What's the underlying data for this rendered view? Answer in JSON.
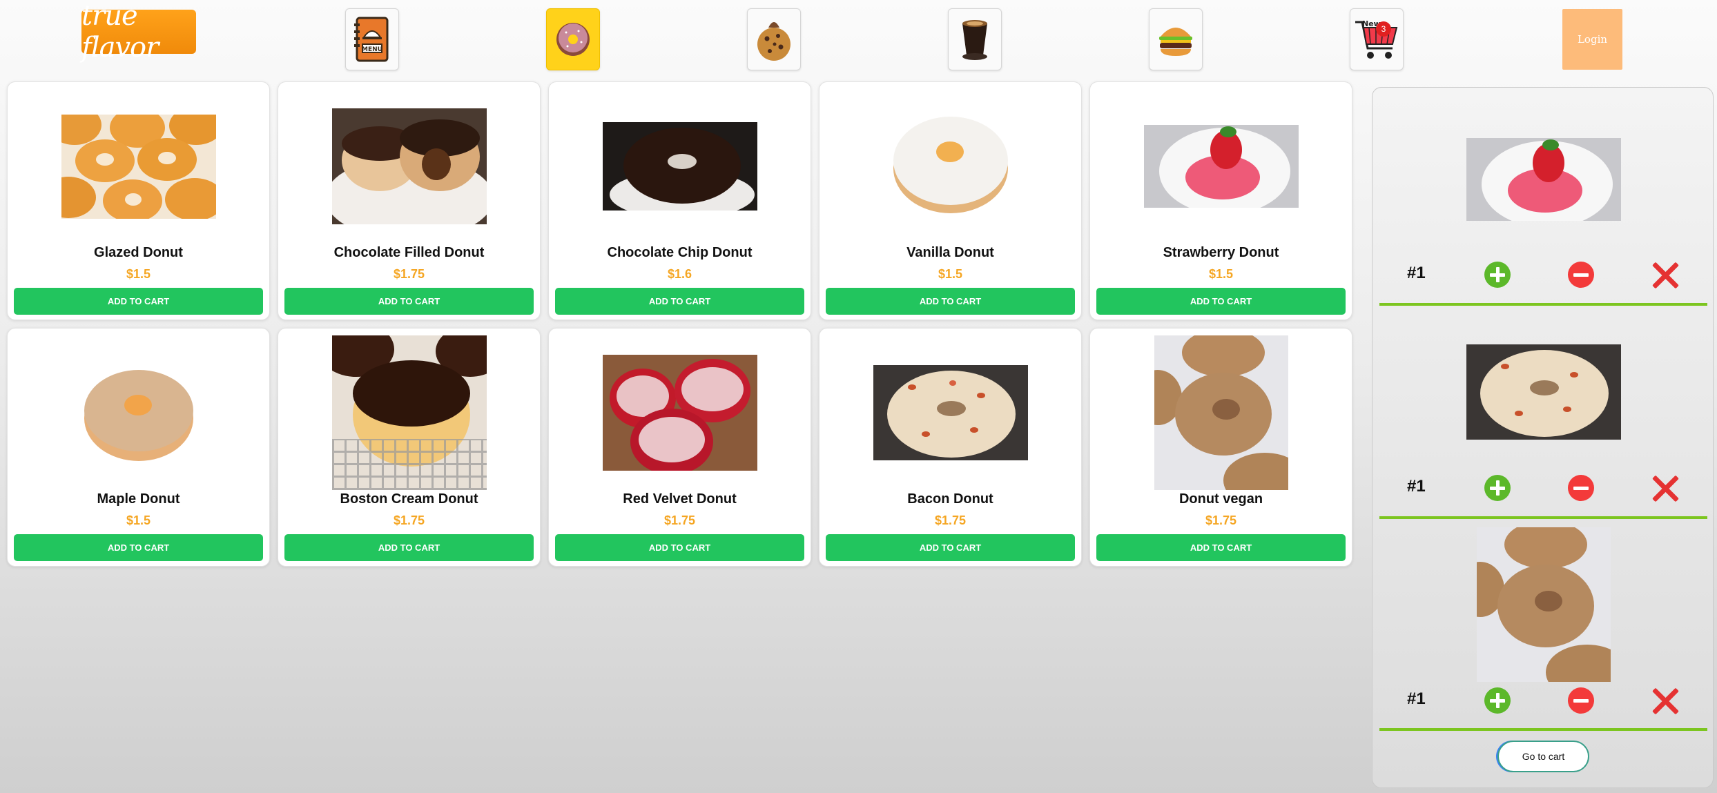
{
  "header": {
    "logo_text": "true flavor",
    "nav": [
      {
        "icon": "menu-book-icon"
      },
      {
        "icon": "donut-icon"
      },
      {
        "icon": "cookie-icon"
      },
      {
        "icon": "coffee-icon"
      },
      {
        "icon": "burger-icon"
      },
      {
        "icon": "shopping-cart-icon",
        "badge": "3"
      }
    ],
    "login_label": "Login"
  },
  "products": [
    {
      "name": "Glazed Donut",
      "price": "$1.5",
      "button": "ADD TO CART"
    },
    {
      "name": "Chocolate Filled Donut",
      "price": "$1.75",
      "button": "ADD TO CART"
    },
    {
      "name": "Chocolate Chip Donut",
      "price": "$1.6",
      "button": "ADD TO CART"
    },
    {
      "name": "Vanilla Donut",
      "price": "$1.5",
      "button": "ADD TO CART"
    },
    {
      "name": "Strawberry Donut",
      "price": "$1.5",
      "button": "ADD TO CART"
    },
    {
      "name": "Maple Donut",
      "price": "$1.5",
      "button": "ADD TO CART"
    },
    {
      "name": "Boston Cream Donut",
      "price": "$1.75",
      "button": "ADD TO CART"
    },
    {
      "name": "Red Velvet Donut",
      "price": "$1.75",
      "button": "ADD TO CART"
    },
    {
      "name": "Bacon Donut",
      "price": "$1.75",
      "button": "ADD TO CART"
    },
    {
      "name": "Donut vegan",
      "price": "$1.75",
      "button": "ADD TO CART"
    }
  ],
  "cart_panel": {
    "items": [
      {
        "qty": "#1"
      },
      {
        "qty": "#1"
      },
      {
        "qty": "#1"
      }
    ],
    "go_to_cart_label": "Go to cart"
  },
  "colors": {
    "add_button": "#22c55e",
    "price": "#f5a623",
    "active_nav": "#ffd21a",
    "login": "#fdbb7a",
    "divider": "#7cc520"
  }
}
